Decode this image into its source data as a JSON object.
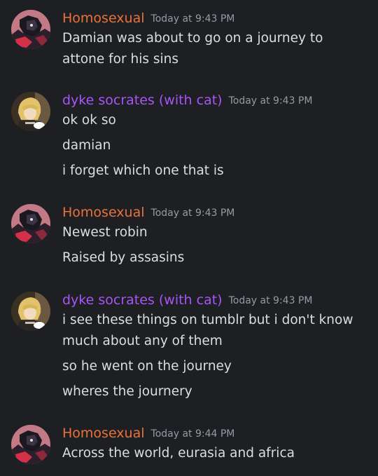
{
  "colors": {
    "background": "#1e1f22",
    "homosexual_name": "#e8733a",
    "dyke_name": "#a855f7",
    "timestamp": "#949ba4",
    "message_text": "#dbdee1"
  },
  "groups": [
    {
      "author": "Homosexual",
      "timestamp": "Today at 9:43 PM",
      "avatar_icon": "dark-anime-character-avatar",
      "messages": [
        "Damian was about to go on a journey to attone for his sins"
      ]
    },
    {
      "author": "dyke socrates (with cat)",
      "timestamp": "Today at 9:43 PM",
      "avatar_icon": "blonde-character-with-cat-avatar",
      "messages": [
        "ok ok so",
        "damian",
        "i forget which one that is"
      ]
    },
    {
      "author": "Homosexual",
      "timestamp": "Today at 9:43 PM",
      "avatar_icon": "dark-anime-character-avatar",
      "messages": [
        "Newest robin",
        "Raised by assasins"
      ]
    },
    {
      "author": "dyke socrates (with cat)",
      "timestamp": "Today at 9:43 PM",
      "avatar_icon": "blonde-character-with-cat-avatar",
      "messages": [
        "i see these things on tumblr but i don't know much about any of them",
        "so he went on the journey",
        "wheres the journery"
      ]
    },
    {
      "author": "Homosexual",
      "timestamp": "Today at 9:44 PM",
      "avatar_icon": "dark-anime-character-avatar",
      "messages": [
        "Across the world, eurasia and africa"
      ]
    }
  ]
}
